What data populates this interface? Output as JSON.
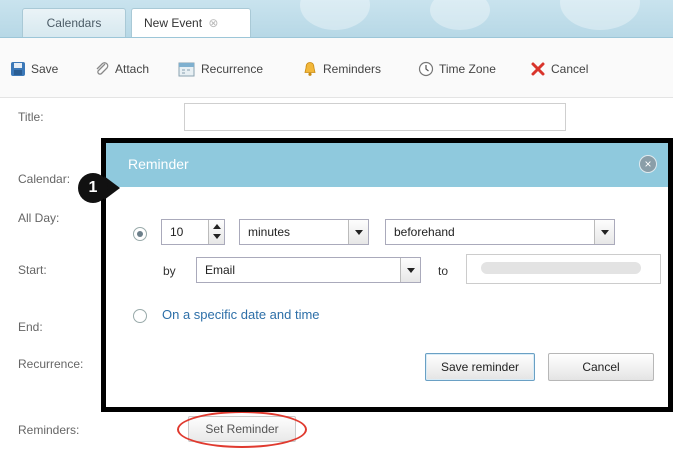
{
  "tabs": [
    {
      "label": "Calendars"
    },
    {
      "label": "New Event",
      "close_glyph": "⊗"
    }
  ],
  "toolbar": {
    "save": "Save",
    "attach": "Attach",
    "recurrence": "Recurrence",
    "reminders": "Reminders",
    "time_zone": "Time Zone",
    "cancel": "Cancel"
  },
  "form": {
    "title": "Title:",
    "calendar": "Calendar:",
    "all_day": "All Day:",
    "start": "Start:",
    "end": "End:",
    "recurrence": "Recurrence:",
    "reminders": "Reminders:",
    "set_reminder": "Set Reminder"
  },
  "dialog": {
    "title": "Reminder",
    "close_glyph": "×",
    "amount": "10",
    "unit": "minutes",
    "timing": "beforehand",
    "by_label": "by",
    "method": "Email",
    "to_label": "to",
    "specific_option": "On a specific date and time",
    "save_button": "Save reminder",
    "cancel_button": "Cancel"
  },
  "callout": {
    "number": "1"
  },
  "icons": {
    "save": "floppy-icon",
    "attach": "paperclip-icon",
    "recurrence": "calendar-icon",
    "reminders": "bell-icon",
    "time_zone": "clock-icon",
    "cancel": "x-icon"
  },
  "colors": {
    "tab_bar": "#b7d8e6",
    "dialog_header": "#8fc9dd",
    "cancel_red": "#d9342b",
    "highlight_oval": "#e03a2f",
    "link_blue": "#2d6fa8"
  }
}
